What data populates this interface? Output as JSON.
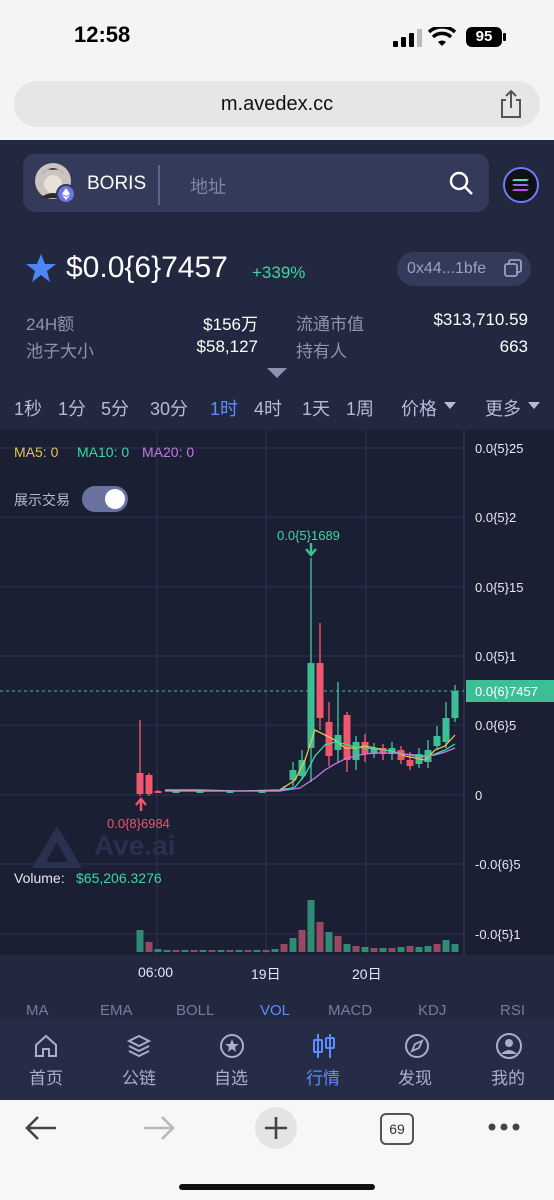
{
  "status": {
    "time": "12:58",
    "battery": "95"
  },
  "browser": {
    "url": "m.avedex.cc",
    "tab_count": "69"
  },
  "search": {
    "symbol": "BORIS",
    "placeholder": "地址"
  },
  "token": {
    "price": "$0.0{6}7457",
    "change": "+339%",
    "contract": "0x44...1bfe",
    "stats": [
      {
        "label": "24H额",
        "value": "$156万"
      },
      {
        "label": "流通市值",
        "value": "$313,710.59"
      },
      {
        "label": "池子大小",
        "value": "$58,127"
      },
      {
        "label": "持有人",
        "value": "663"
      }
    ]
  },
  "tabs": [
    "1秒",
    "1分",
    "5分",
    "30分",
    "1时",
    "4时",
    "1天",
    "1周",
    "价格",
    "更多"
  ],
  "active_tab": "1时",
  "chart": {
    "ma_labels": [
      "MA5: 0",
      "MA10: 0",
      "MA20: 0"
    ],
    "show_trades_label": "展示交易",
    "y_ticks": [
      "0.0{5}25",
      "0.0{5}2",
      "0.0{5}15",
      "0.0{5}1",
      "0.0{6}5",
      "0",
      "-0.0{6}5",
      "-0.0{5}1"
    ],
    "current_price": "0.0{6}7457",
    "high_label": "0.0{5}1689",
    "low_label": "0.0{8}6984",
    "volume_label": "Volume:",
    "volume_value": "$65,206.3276",
    "watermark": "Ave.ai",
    "x_ticks": [
      "06:00",
      "19日",
      "20日"
    ]
  },
  "chart_data": {
    "type": "candlestick",
    "ylabel": "",
    "x_ticks": [
      "06:00",
      "19日",
      "20日"
    ],
    "y_ticks": [
      "0.0{5}25",
      "0.0{5}2",
      "0.0{5}15",
      "0.0{5}1",
      "0.0{6}5",
      "0",
      "-0.0{6}5",
      "-0.0{5}1"
    ],
    "last_price": "0.0{6}7457",
    "max_high": "0.0{5}1689",
    "min_low": "0.0{8}6984"
  },
  "indicators": [
    "MA",
    "EMA",
    "BOLL",
    "VOL",
    "MACD",
    "KDJ",
    "RSI"
  ],
  "nav": [
    {
      "label": "首页",
      "icon": "home-icon"
    },
    {
      "label": "公链",
      "icon": "layers-icon"
    },
    {
      "label": "自选",
      "icon": "star-circle-icon"
    },
    {
      "label": "行情",
      "icon": "candles-icon"
    },
    {
      "label": "发现",
      "icon": "compass-icon"
    },
    {
      "label": "我的",
      "icon": "user-icon"
    }
  ],
  "colors": {
    "up": "#3dbf96",
    "down": "#f0566c",
    "accent": "#5b8dff",
    "bg": "#232841"
  }
}
